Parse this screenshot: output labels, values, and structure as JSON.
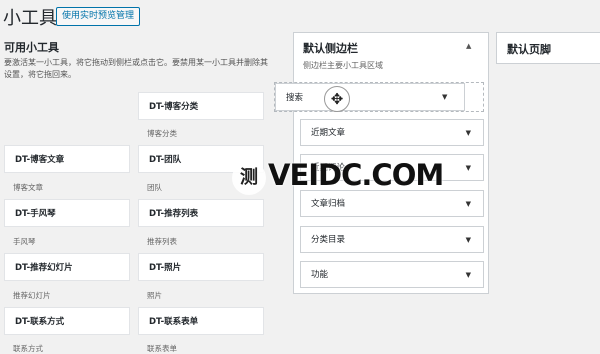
{
  "header": {
    "title": "小工具",
    "manage_button": "使用实时预览管理"
  },
  "available": {
    "title": "可用小工具",
    "description": "要激活某一小工具，将它拖动到侧栏或点击它。要禁用某一小工具并删除其设置，将它拖回来。",
    "widgets": [
      {
        "name": "DT-博客分类",
        "desc": "博客分类"
      },
      {
        "name": "DT-博客文章",
        "desc": "博客文章"
      },
      {
        "name": "DT-团队",
        "desc": "团队"
      },
      {
        "name": "DT-手风琴",
        "desc": "手风琴"
      },
      {
        "name": "DT-推荐列表",
        "desc": "推荐列表"
      },
      {
        "name": "DT-推荐幻灯片",
        "desc": "推荐幻灯片"
      },
      {
        "name": "DT-照片",
        "desc": "照片"
      },
      {
        "name": "DT-联系方式",
        "desc": "联系方式"
      },
      {
        "name": "DT-联系表单",
        "desc": "联系表单"
      }
    ]
  },
  "sidebar": {
    "title": "默认侧边栏",
    "description": "侧边栏主要小工具区域",
    "dragging_widget": "搜索",
    "widgets": [
      "近期文章",
      "近期评论",
      "文章归档",
      "分类目录",
      "功能"
    ]
  },
  "footer": {
    "title": "默认页脚"
  },
  "watermark": {
    "glyph": "测",
    "text": "VEIDC.COM"
  },
  "icons": {
    "arrow": "▼",
    "collapse": "▲",
    "move": "✥"
  }
}
